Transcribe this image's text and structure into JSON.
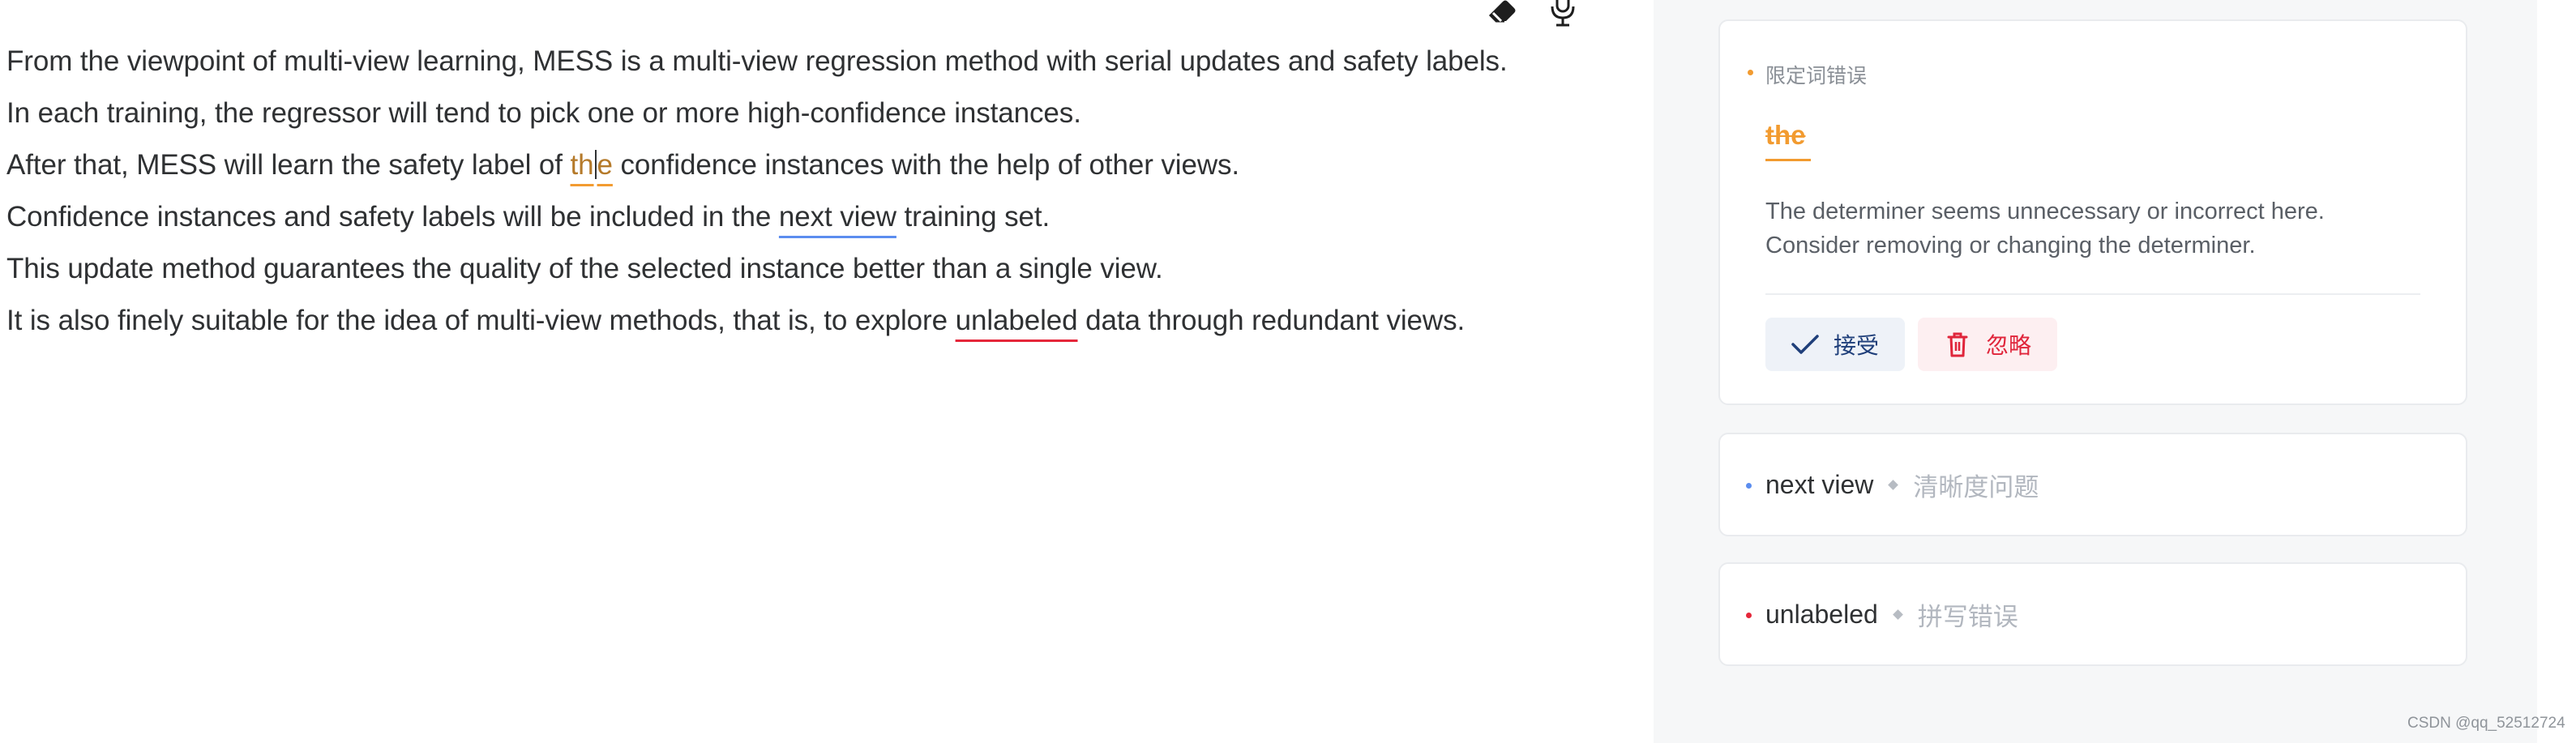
{
  "editor": {
    "lines": [
      {
        "text": "From the viewpoint of multi-view learning, MESS is a multi-view regression method with serial updates and safety labels."
      },
      {
        "text": "In each training, the regressor will tend to pick one or more high-confidence instances."
      },
      {
        "before": "After that, MESS will learn the safety label of ",
        "flag_a": "th",
        "flag_b": "e",
        "after": " confidence instances with the help of other views."
      },
      {
        "before": "Confidence instances and safety labels will be included in the ",
        "flag": "next view",
        "after": " training set."
      },
      {
        "text": "This update method guarantees the quality of the selected instance better than a single view."
      },
      {
        "before": "It is also finely suitable for the idea of multi-view methods, that is, to explore ",
        "flag": "unlabeled",
        "after": " data through redundant views."
      }
    ],
    "toolbar": {
      "eraser_icon": "eraser-icon",
      "mic_icon": "microphone-icon"
    }
  },
  "panel": {
    "active_card": {
      "category": "限定词错误",
      "word": "the",
      "description_line1": "The determiner seems unnecessary or incorrect here.",
      "description_line2": "Consider removing or changing the determiner.",
      "accept_label": "接受",
      "ignore_label": "忽略",
      "accent_color": "#f29b30"
    },
    "issues": [
      {
        "word": "next view",
        "category": "清晰度问题",
        "color": "#5b8def"
      },
      {
        "word": "unlabeled",
        "category": "拼写错误",
        "color": "#e5273a"
      }
    ]
  },
  "watermark": "CSDN @qq_52512724"
}
